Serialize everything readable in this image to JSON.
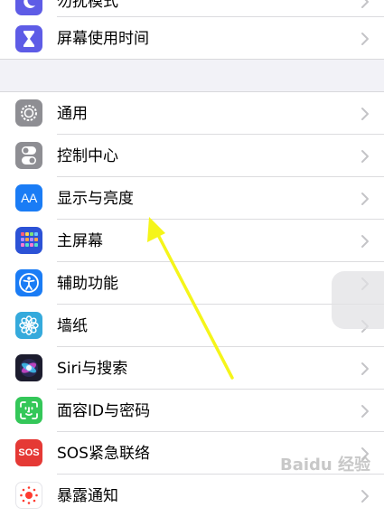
{
  "settings": {
    "top_partial_label": "勿扰模式",
    "screen_time_label": "屏幕使用时间",
    "items": [
      {
        "label": "通用",
        "icon": "gear-icon",
        "color": "#8e8e93"
      },
      {
        "label": "控制中心",
        "icon": "toggle-icon",
        "color": "#8e8e93"
      },
      {
        "label": "显示与亮度",
        "icon": "text-size-icon",
        "color": "#1a7cf5"
      },
      {
        "label": "主屏幕",
        "icon": "home-screen-grid-icon",
        "color": "#2c52d6"
      },
      {
        "label": "辅助功能",
        "icon": "accessibility-icon",
        "color": "#1a7cf5"
      },
      {
        "label": "墙纸",
        "icon": "flower-icon",
        "color": "#35aadc"
      },
      {
        "label": "Siri与搜索",
        "icon": "siri-icon",
        "color": "#1c1c2e"
      },
      {
        "label": "面容ID与密码",
        "icon": "face-id-icon",
        "color": "#34c759"
      },
      {
        "label": "SOS紧急联络",
        "icon": "sos-icon",
        "color": "#e53935"
      },
      {
        "label": "暴露通知",
        "icon": "exposure-notification-icon",
        "color": "#ffffff"
      }
    ],
    "text_size_glyph": "AA",
    "sos_glyph": "SOS"
  },
  "watermark": "Baidu 经验",
  "annotation": {
    "color": "#f5f51a"
  }
}
